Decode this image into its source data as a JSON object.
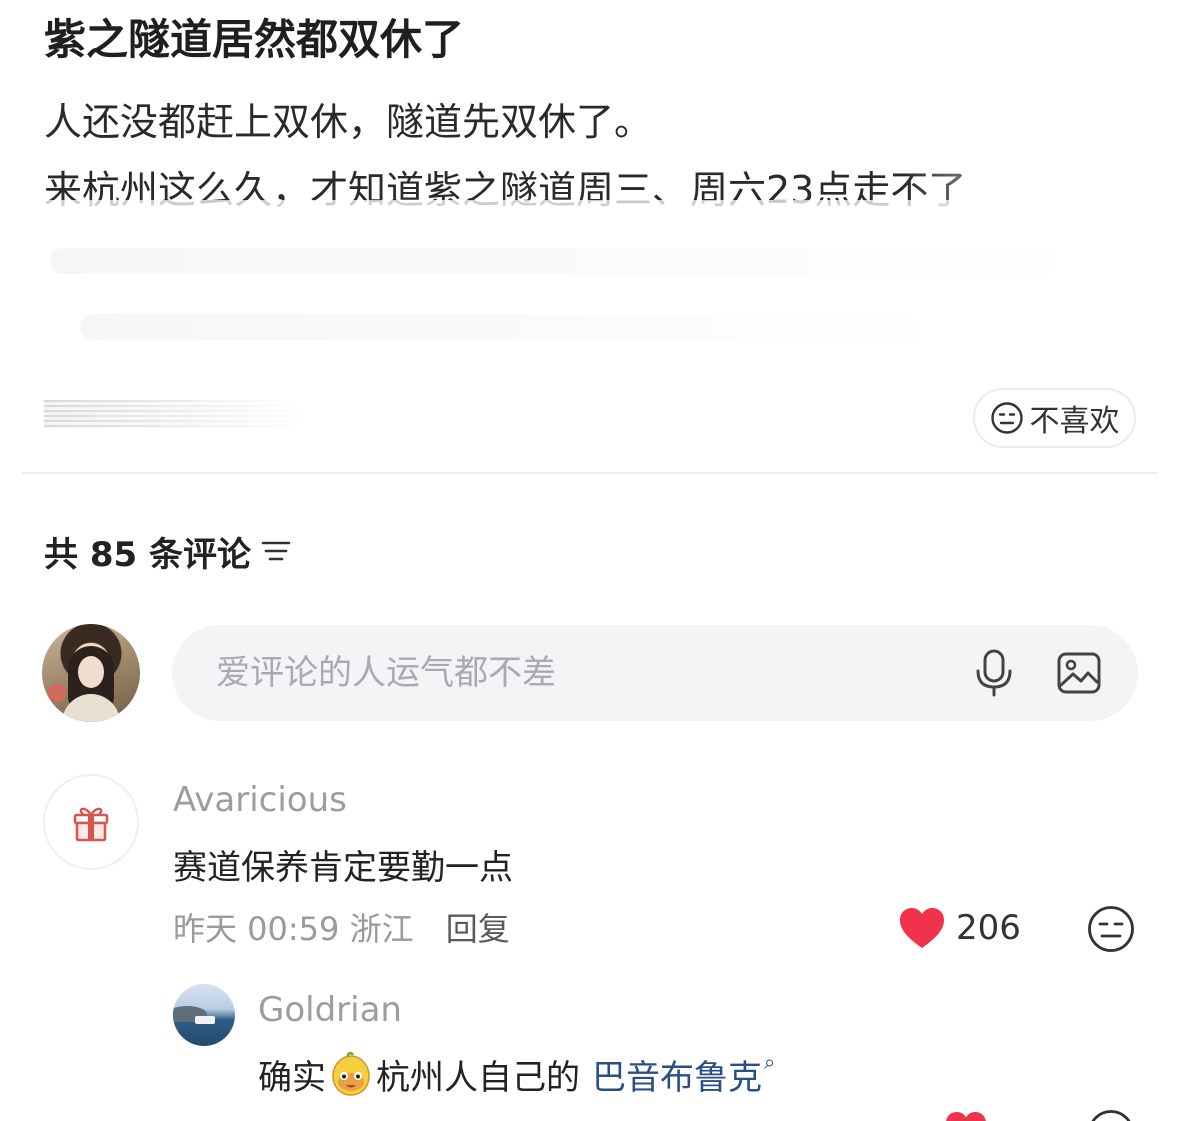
{
  "post": {
    "title": "紫之隧道居然都双休了",
    "line1": "人还没都赶上双休，隧道先双休了。",
    "line2": "来杭州这么久，才知道紫之隧道周三、周六23点走不了",
    "dislike_label": "不喜欢"
  },
  "comments_section": {
    "header": "共 85 条评论",
    "input_placeholder": "爱评论的人运气都不差"
  },
  "comments": [
    {
      "username": "Avaricious",
      "text": "赛道保养肯定要勤一点",
      "time": "昨天 00:59",
      "location": "浙江",
      "reply_label": "回复",
      "likes": "206"
    }
  ],
  "reply": {
    "username": "Goldrian",
    "text_before": "确实",
    "text_after": "杭州人自己的",
    "topic_link": "巴音布鲁克"
  },
  "colors": {
    "heart": "#f0324a",
    "link": "#2a4f86",
    "muted": "#9d9d9d"
  }
}
